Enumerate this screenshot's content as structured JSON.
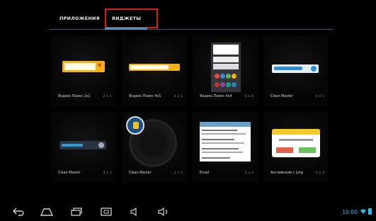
{
  "tabs": {
    "apps": "ПРИЛОЖЕНИЯ",
    "widgets": "ВИДЖЕТЫ"
  },
  "widgets": [
    {
      "label": "Яндекс.Поиск 2х1",
      "size": "2 × 1"
    },
    {
      "label": "Яндекс.Поиск 4х1",
      "size": "4 × 1"
    },
    {
      "label": "Яндекс.Поиск 4х4",
      "size": "4 × 4"
    },
    {
      "label": "Clean Master",
      "size": "4 × 1"
    },
    {
      "label": "Clean Master",
      "size": "4 × 1"
    },
    {
      "label": "Clean Master",
      "size": "1 × 1"
    },
    {
      "label": "Email",
      "size": "3 × 3"
    },
    {
      "label": "Английский с Ling",
      "size": "3 × 2"
    }
  ],
  "preview": {
    "yandex_logo": "Я"
  },
  "status": {
    "time": "10:00"
  },
  "colors": {
    "accent": "#33b5e5",
    "highlight_box": "#e0191a",
    "yandex_bar": "#f3b21a"
  },
  "nav": {
    "back": "back-icon",
    "home": "home-icon",
    "recents": "recents-icon",
    "screenshot": "screenshot-icon",
    "vol_down": "volume-down-icon",
    "vol_up": "volume-up-icon"
  }
}
